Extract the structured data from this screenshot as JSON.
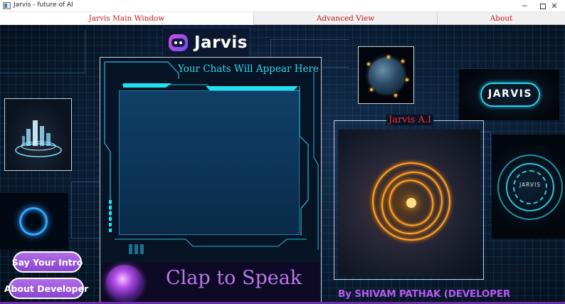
{
  "window": {
    "title": "Jarvis - future of AI",
    "controls": {
      "minimize": "─",
      "close": "✕"
    }
  },
  "tabs": [
    {
      "label": "Jarvis Main Window",
      "selected": true
    },
    {
      "label": "Advanced View",
      "selected": false
    },
    {
      "label": "About",
      "selected": false
    }
  ],
  "logo": {
    "text": "Jarvis"
  },
  "chat": {
    "title": "Your Chats Will Appear Here"
  },
  "mic": {
    "label": "Clap to Speak"
  },
  "buttons": {
    "say_intro": "Say Your Intro",
    "about_developer": "About Developer"
  },
  "badge": {
    "text": "JARVIS"
  },
  "ai_panel": {
    "title": "Jarvis A.I"
  },
  "ring_panel": {
    "label": "JARVIS"
  },
  "byline": "By SHIVAM PATHAK (DEVELOPER",
  "colors": {
    "tab_text": "#c0161a",
    "chat_title": "#2fd8ea",
    "accent_purple": "#b06ee8",
    "ai_title": "#ff2a2a"
  }
}
